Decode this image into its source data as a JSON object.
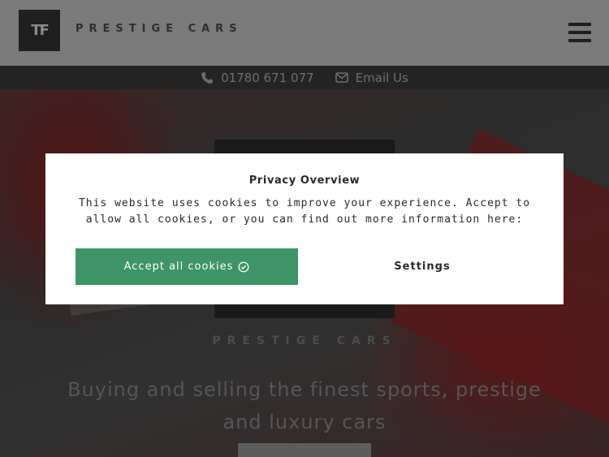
{
  "header": {
    "logo_text": "TF",
    "brand": "PRESTIGE CARS",
    "menu_icon": "hamburger-menu-icon"
  },
  "contact": {
    "phone": "01780 671 077",
    "phone_icon": "phone-icon",
    "email_label": "Email Us",
    "email_icon": "envelope-icon"
  },
  "hero": {
    "brand": "PRESTIGE CARS",
    "tagline": "Buying and selling the finest sports, prestige and luxury cars"
  },
  "cookie_modal": {
    "title": "Privacy Overview",
    "text": "This website uses cookies to improve your experience. Accept to allow all cookies, or you can find out more information here:",
    "accept_label": "Accept all cookies",
    "accept_icon": "check-circle-icon",
    "settings_label": "Settings",
    "accept_color": "#3d9466"
  }
}
